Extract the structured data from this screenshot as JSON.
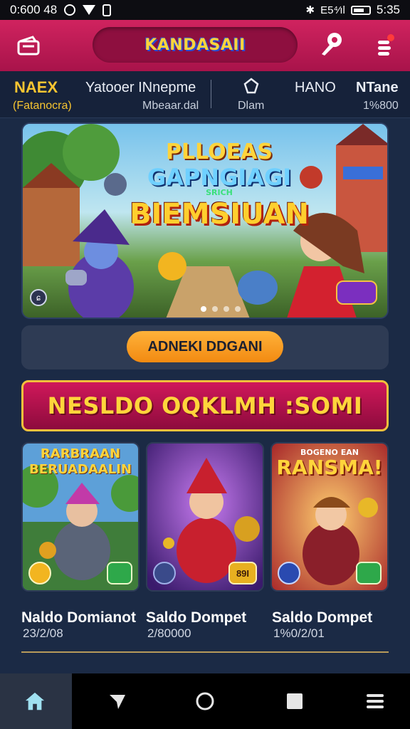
{
  "status_bar": {
    "left_text": "0:600 48",
    "signal_text": "E5⁴⁄ıl",
    "time": "5:35"
  },
  "header": {
    "logo_text": "KANDASAII",
    "left_icon": "wallet-icon",
    "center_icon": "rocket-search-icon",
    "right_icon": "menu-notification-icon",
    "accent_color": "#c81e58"
  },
  "stats": {
    "gold_label": "NAEX",
    "gold_sub": "(Fatanocra)",
    "user_line1": "Yatooer  INnepme",
    "user_line2": "Mbeaar.dal",
    "icon_label": "Dlam",
    "col3_label": "HANO",
    "col4_label": "NTane",
    "col4_value": "1%800"
  },
  "banner": {
    "title_line1": "PLLOEAS",
    "title_line2": "GAPNGIAGI",
    "title_small": "SRICH",
    "title_line3": "BIEMSIUAN",
    "slide_count": 4,
    "active_slide": 1
  },
  "action": {
    "button_label": "ADNEKI DDGANI"
  },
  "promo": {
    "text": "NESLDO OQKLMH :SOMI"
  },
  "cards": [
    {
      "title": "RARBRAAN\nBERUADAALIN",
      "label": "Naldo Domianot",
      "value": "23/2/08",
      "bg": "#3f7d3a"
    },
    {
      "title": "",
      "label": "Saldo Dompet",
      "value": "2/80000",
      "bg": "#5a2a8c"
    },
    {
      "title": "RANSMA!",
      "small_title": "BOGENO EAN",
      "label": "Saldo Dompet",
      "value": "1%0/2/01",
      "bg": "#c0413a"
    }
  ],
  "card_badge": "89I",
  "nav": {
    "items": [
      "home-icon",
      "send-icon",
      "circle-icon",
      "square-icon",
      "menu-icon"
    ],
    "active": "home-icon"
  }
}
